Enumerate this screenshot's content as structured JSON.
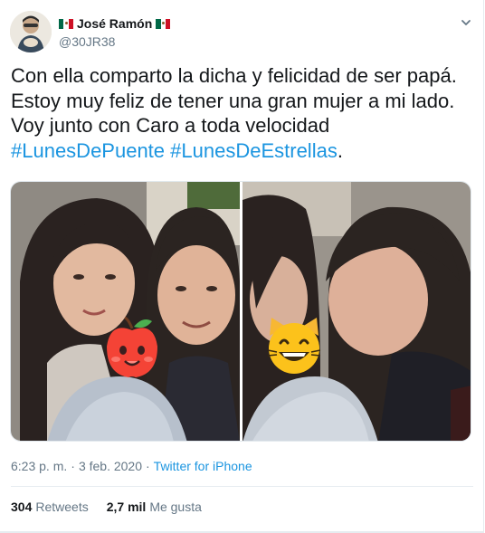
{
  "author": {
    "flag_left": "🇲🇽",
    "name": "José Ramón",
    "flag_right": "🇲🇽",
    "handle": "@30JR38"
  },
  "tweet": {
    "text_plain": "Con ella comparto la dicha y felicidad de ser papá. Estoy muy feliz de tener una gran mujer a mi lado. Voy junto con Caro a toda velocidad ",
    "hashtag_1": "#LunesDePuente",
    "space": " ",
    "hashtag_2": "#LunesDeEstrellas",
    "end": "."
  },
  "meta": {
    "time": "6:23 p. m.",
    "separator1": "·",
    "date": "3 feb. 2020",
    "separator2": "·",
    "source": "Twitter for iPhone"
  },
  "stats": {
    "retweets_count": "304",
    "retweets_label": "Retweets",
    "likes_count": "2,7 mil",
    "likes_label": "Me gusta"
  },
  "icons": {
    "caret": "chevron-down-icon",
    "emoji_left": "apple-emoji",
    "emoji_right": "grinning-cat-emoji"
  },
  "colors": {
    "link": "#1b95e0",
    "muted": "#657786",
    "text": "#14171a"
  }
}
